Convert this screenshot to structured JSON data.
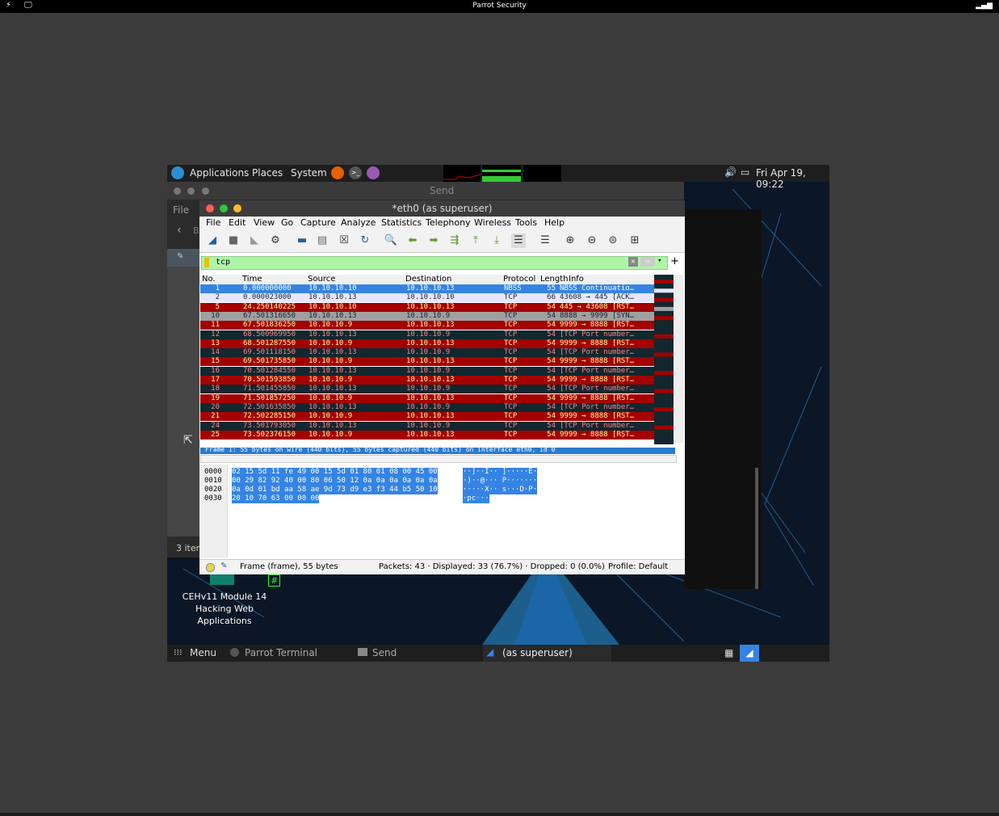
{
  "host": {
    "title": "Parrot Security"
  },
  "topbar": {
    "menus": [
      "Applications",
      "Places",
      "System"
    ],
    "clock": "Fri Apr 19, 09:22"
  },
  "file_manager": {
    "title": "Send",
    "file_menu": "File",
    "back_label": "B",
    "status": "3 iten"
  },
  "desktop": {
    "icon_label_lines": [
      "CEHv11 Module 14",
      "Hacking Web",
      "Applications"
    ],
    "terminal_prompt": "#"
  },
  "wireshark": {
    "title": "*eth0 (as superuser)",
    "menu": [
      "File",
      "Edit",
      "View",
      "Go",
      "Capture",
      "Analyze",
      "Statistics",
      "Telephony",
      "Wireless",
      "Tools",
      "Help"
    ],
    "filter": "tcp",
    "columns": [
      "No.",
      "Time",
      "Source",
      "Destination",
      "Protocol",
      "Length",
      "Info"
    ],
    "packets": [
      {
        "no": "1",
        "time": "0.000000000",
        "src": "10.10.10.10",
        "dst": "10.10.10.13",
        "proto": "NBSS",
        "len": "55",
        "info": "NBSS Continuatio…",
        "style": "selected"
      },
      {
        "no": "2",
        "time": "0.000023000",
        "src": "10.10.10.13",
        "dst": "10.10.10.10",
        "proto": "TCP",
        "len": "66",
        "info": "43608 → 445 [ACK…",
        "style": "light"
      },
      {
        "no": "5",
        "time": "24.250140225",
        "src": "10.10.10.10",
        "dst": "10.10.10.13",
        "proto": "TCP",
        "len": "54",
        "info": "445 → 43608 [RST…",
        "style": "red"
      },
      {
        "no": "10",
        "time": "67.501316650",
        "src": "10.10.10.13",
        "dst": "10.10.10.9",
        "proto": "TCP",
        "len": "54",
        "info": "8888 → 9999 [SYN…",
        "style": "gray"
      },
      {
        "no": "11",
        "time": "67.501836250",
        "src": "10.10.10.9",
        "dst": "10.10.10.13",
        "proto": "TCP",
        "len": "54",
        "info": "9999 → 8888 [RST…",
        "style": "red"
      },
      {
        "no": "12",
        "time": "68.500969950",
        "src": "10.10.10.13",
        "dst": "10.10.10.9",
        "proto": "TCP",
        "len": "54",
        "info": "[TCP Port number…",
        "style": "dark"
      },
      {
        "no": "13",
        "time": "68.501287550",
        "src": "10.10.10.9",
        "dst": "10.10.10.13",
        "proto": "TCP",
        "len": "54",
        "info": "9999 → 8888 [RST…",
        "style": "red"
      },
      {
        "no": "14",
        "time": "69.501118150",
        "src": "10.10.10.13",
        "dst": "10.10.10.9",
        "proto": "TCP",
        "len": "54",
        "info": "[TCP Port number…",
        "style": "dark"
      },
      {
        "no": "15",
        "time": "69.501735850",
        "src": "10.10.10.9",
        "dst": "10.10.10.13",
        "proto": "TCP",
        "len": "54",
        "info": "9999 → 8888 [RST…",
        "style": "red"
      },
      {
        "no": "16",
        "time": "70.501284550",
        "src": "10.10.10.13",
        "dst": "10.10.10.9",
        "proto": "TCP",
        "len": "54",
        "info": "[TCP Port number…",
        "style": "dark"
      },
      {
        "no": "17",
        "time": "70.501593850",
        "src": "10.10.10.9",
        "dst": "10.10.10.13",
        "proto": "TCP",
        "len": "54",
        "info": "9999 → 8888 [RST…",
        "style": "red"
      },
      {
        "no": "18",
        "time": "71.501455850",
        "src": "10.10.10.13",
        "dst": "10.10.10.9",
        "proto": "TCP",
        "len": "54",
        "info": "[TCP Port number…",
        "style": "dark"
      },
      {
        "no": "19",
        "time": "71.501857250",
        "src": "10.10.10.9",
        "dst": "10.10.10.13",
        "proto": "TCP",
        "len": "54",
        "info": "9999 → 8888 [RST…",
        "style": "red"
      },
      {
        "no": "20",
        "time": "72.501635850",
        "src": "10.10.10.13",
        "dst": "10.10.10.9",
        "proto": "TCP",
        "len": "54",
        "info": "[TCP Port number…",
        "style": "dark"
      },
      {
        "no": "21",
        "time": "72.502285150",
        "src": "10.10.10.9",
        "dst": "10.10.10.13",
        "proto": "TCP",
        "len": "54",
        "info": "9999 → 8888 [RST…",
        "style": "red"
      },
      {
        "no": "24",
        "time": "73.501793050",
        "src": "10.10.10.13",
        "dst": "10.10.10.9",
        "proto": "TCP",
        "len": "54",
        "info": "[TCP Port number…",
        "style": "dark"
      },
      {
        "no": "25",
        "time": "73.502376150",
        "src": "10.10.10.9",
        "dst": "10.10.10.13",
        "proto": "TCP",
        "len": "54",
        "info": "9999 → 8888 [RST…",
        "style": "red"
      }
    ],
    "detail": "Frame 1: 55 bytes on wire (440 bits), 55 bytes captured (440 bits) on interface eth0, id 0",
    "hex": [
      {
        "offset": "0000",
        "bytes": "02 15 5d 11 fe 49 00 15  5d 01 80 01 08 00 45 00",
        "ascii": "··]··I·· ]·····E·"
      },
      {
        "offset": "0010",
        "bytes": "00 29 82 92 40 00 80 06  50 12 0a 0a 0a 0a 0a 0a",
        "ascii": "·)··@··· P·······"
      },
      {
        "offset": "0020",
        "bytes": "0a 0d 01 bd aa 58 ae 9d  73 d9 e3 f3 44 b5 50 10",
        "ascii": "·····X·· s···D·P·"
      },
      {
        "offset": "0030",
        "bytes": "20 10 70 63 00 00 00",
        "ascii": "·pc···"
      }
    ],
    "status": {
      "frame": "Frame (frame), 55 bytes",
      "packets": "Packets: 43 · Displayed: 33 (76.7%) · Dropped: 0 (0.0%)",
      "profile": "Profile: Default"
    }
  },
  "taskbar": {
    "menu": "Menu",
    "tasks": [
      "Parrot Terminal",
      "Send",
      "(as superuser)"
    ]
  },
  "colors": {
    "red_row": "#a40000",
    "dark_row": "#12272e",
    "red_text": "#fffc9c",
    "dark_text": "#f78787",
    "selected": "#3584e4"
  }
}
